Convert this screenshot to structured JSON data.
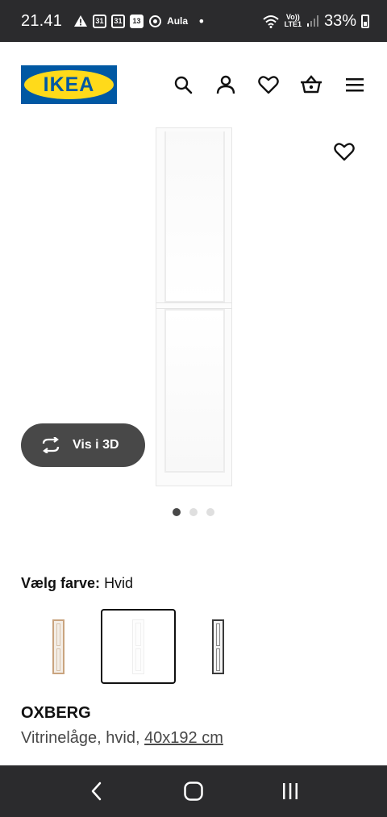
{
  "status_bar": {
    "time": "21.41",
    "cal1": "31",
    "cal2": "31",
    "cal3": "13",
    "aula": "Aula",
    "dot": "•",
    "volte_top": "Vo))",
    "volte_bottom": "LTE1",
    "battery_percent": "33%"
  },
  "header": {
    "logo_text": "IKEA",
    "icons": [
      "search-icon",
      "user-icon",
      "heart-icon",
      "basket-icon",
      "menu-icon"
    ]
  },
  "gallery": {
    "view_3d_label": "Vis i 3D",
    "pager_total": 3,
    "pager_active": 1
  },
  "color_picker": {
    "label": "Vælg farve:",
    "value": "Hvid",
    "swatches": [
      {
        "color": "#c9a47f"
      },
      {
        "color": "#ffffff"
      },
      {
        "color": "#3a3a3a"
      }
    ],
    "selected_index": 1
  },
  "product": {
    "name": "OXBERG",
    "description": "Vitrinelåge, hvid,",
    "size": "40x192 cm"
  },
  "colors": {
    "status_bar_bg": "#2b2b2d",
    "ikea_blue": "#0058a3",
    "ikea_yellow": "#ffda1a",
    "button_dark": "#484848"
  }
}
